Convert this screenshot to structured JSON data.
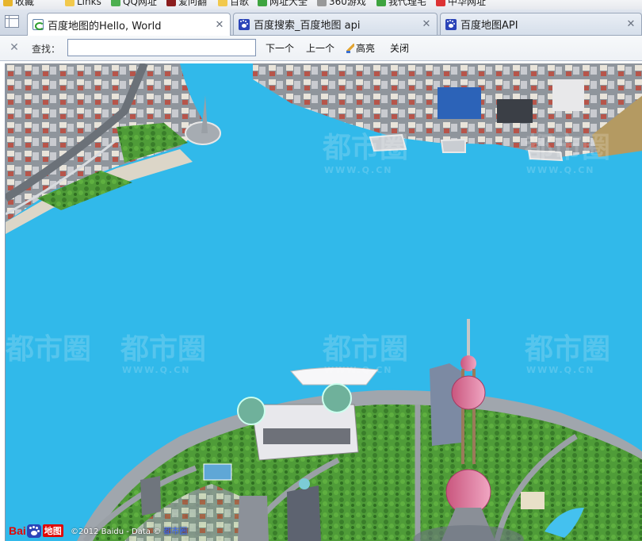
{
  "favorites_bar": {
    "items": [
      {
        "label": "收藏",
        "icon": "star-icon"
      },
      {
        "label": "Links",
        "icon": "folder-icon"
      },
      {
        "label": "QQ网址",
        "icon": "qq-icon"
      },
      {
        "label": "爱问翻",
        "icon": "translate-icon"
      },
      {
        "label": "百歌",
        "icon": "folder-icon"
      },
      {
        "label": "网址大全",
        "icon": "globe-icon"
      },
      {
        "label": "360游戏",
        "icon": "game-icon"
      },
      {
        "label": "我代理宅",
        "icon": "globe-icon"
      },
      {
        "label": "中华网址",
        "icon": "globe-icon"
      }
    ]
  },
  "tabs": [
    {
      "title": "百度地图的Hello, World",
      "icon": "page-icon",
      "active": true
    },
    {
      "title": "百度搜索_百度地图 api",
      "icon": "baidu-paw-icon",
      "active": false
    },
    {
      "title": "百度地图API",
      "icon": "baidu-paw-icon",
      "active": false
    }
  ],
  "findbar": {
    "close_glyph": "✕",
    "label": "查找：",
    "input_value": "",
    "input_placeholder": "",
    "next_label": "下一个",
    "prev_label": "上一个",
    "highlight_label": "高亮",
    "close_label": "关闭"
  },
  "map": {
    "watermark_text": "都市圈",
    "watermark_sub": "WWW.Q.CN",
    "logo": {
      "text_bai": "Bai",
      "text_du": "du",
      "text_map": "地图"
    },
    "copyright": {
      "text": "©2012 Baidu - Data ©",
      "link": "都市圈"
    }
  },
  "colors": {
    "water": "#31b9ea",
    "land_green": "#4d9a36",
    "road_gray": "#9aa0a6",
    "baidu_red": "#e10602",
    "baidu_blue": "#2b44b8"
  }
}
